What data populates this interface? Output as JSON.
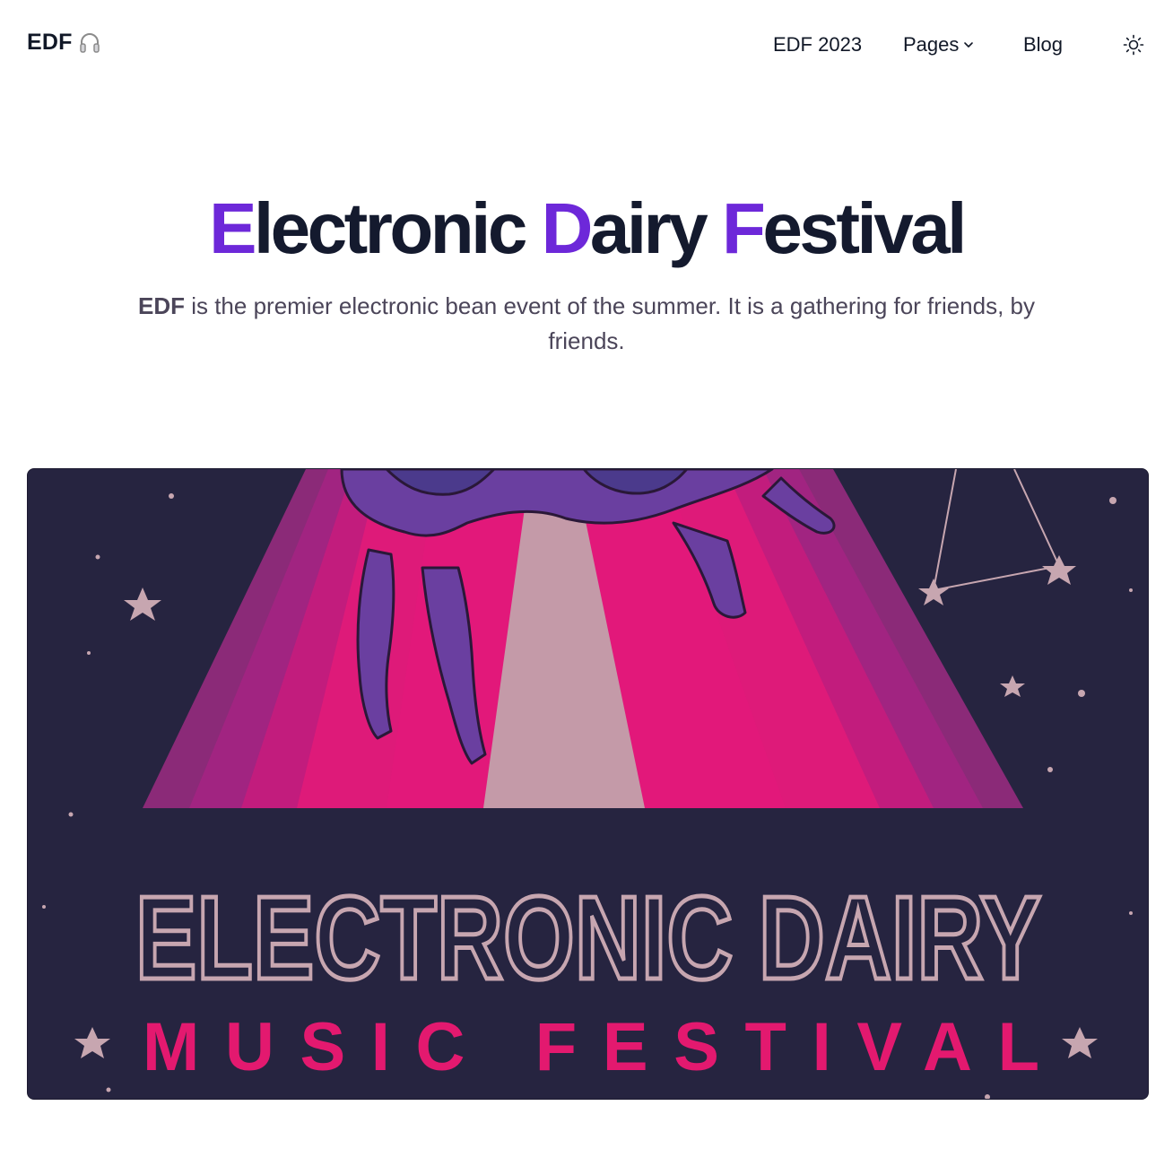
{
  "nav": {
    "brand": "EDF",
    "brand_icon": "headphones-icon",
    "links": {
      "edf2023": "EDF 2023",
      "pages": "Pages",
      "blog": "Blog"
    },
    "theme_icon": "sun-icon"
  },
  "hero": {
    "title_parts": [
      "E",
      "lectronic ",
      "D",
      "airy ",
      "F",
      "estival"
    ],
    "accent_color": "#6d28d9",
    "subtitle_strong": "EDF",
    "subtitle_rest": " is the premier electronic bean event of the summer. It is a gathering for friends, by friends."
  },
  "poster": {
    "line1": "ELECTRONIC DAIRY",
    "line2": "MUSIC FESTIVAL",
    "colors": {
      "background": "#262440",
      "beam_pink": "#e0197a",
      "beam_light": "#c49aa8",
      "letters_outline": "#c7a6b0",
      "letters_pink": "#e3196f"
    }
  }
}
